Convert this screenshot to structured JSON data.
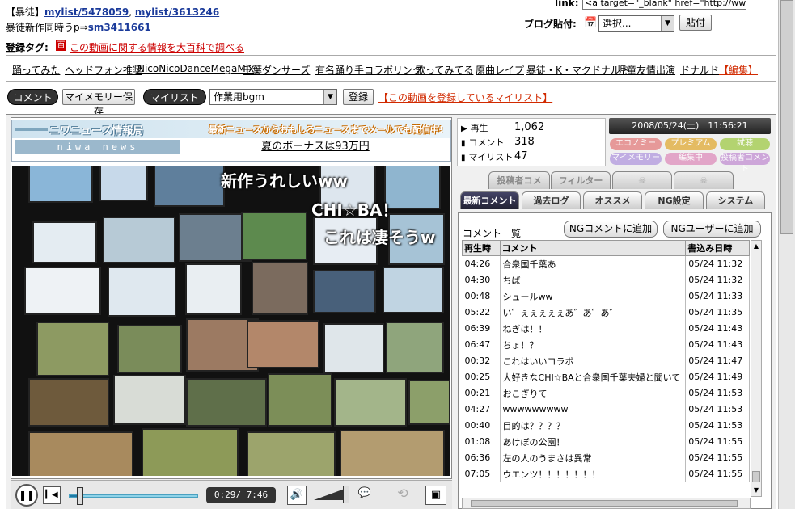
{
  "header": {
    "fav_prefix": "【暴徒】",
    "mylist1": "mylist/5478059",
    "sep": ", ",
    "mylist2": "mylist/3613246",
    "latest_prefix": "暴徒新作同時うp⇒",
    "latest_link": "sm3411661",
    "link_label": "link:",
    "link_value": "<a target=\"_blank\" href=\"http://www.ni",
    "blog_label": "ブログ貼付:",
    "blog_select": "選択...",
    "blog_button": "貼付"
  },
  "tags": {
    "label": "登録タグ:",
    "dict_badge": "百",
    "dict_link": "この動画に関する情報を大百科で調べる",
    "items": [
      "踊ってみた",
      "ヘッドフォン推奨",
      "NicoNicoDanceMegaMix",
      "千葉ダンサーズ",
      "有名踊り手コラボリンク",
      "歌ってみてる",
      "原曲レイプ",
      "暴徒・K・マクドナルド",
      "児童友情出演",
      "ドナルド"
    ],
    "edit": "【編集】"
  },
  "toolbar": {
    "comment_btn": "コメント",
    "memory_btn": "マイメモリー保存",
    "mylist_btn": "マイリスト",
    "mylist_select": "作業用bgm",
    "register_btn": "登録",
    "mylist_link": "【この動画を登録しているマイリスト】"
  },
  "news": {
    "title": "ニワニュース情報局",
    "tagline": "最新ニュースからおもしろニュースまでメールでも配信中!",
    "logo": "niwa news",
    "headline": "夏のボーナスは93万円"
  },
  "danmaku": [
    "新作うれしいww",
    "CHI☆BA！",
    "これは凄そうw"
  ],
  "controls": {
    "time": "0:29/ 7:46",
    "progress": 0.062
  },
  "stats": {
    "views_label": "再生",
    "views": "1,062",
    "comments_label": "コメント",
    "comments": "318",
    "mylist_label": "マイリスト",
    "mylist": "47"
  },
  "datetime": "2008/05/24(土)　11:56:21",
  "chips": [
    "エコノミー",
    "プレミアム",
    "試聴",
    "マイメモリー",
    "編集中",
    "投稿者コメント"
  ],
  "upper_tabs": [
    "投稿者コメ",
    "フィルター"
  ],
  "tabs": [
    "最新コメント",
    "過去ログ",
    "オススメ",
    "NG設定",
    "システム"
  ],
  "comment_panel": {
    "title": "コメント一覧",
    "ng_comment_btn": "NGコメントに追加",
    "ng_user_btn": "NGユーザーに追加",
    "headers": [
      "再生時",
      "コメント",
      "書込み日時"
    ],
    "rows": [
      [
        "04:26",
        "合衆国千葉あ",
        "05/24 11:32"
      ],
      [
        "04:30",
        "ちば",
        "05/24 11:32"
      ],
      [
        "00:48",
        "シュールww",
        "05/24 11:33"
      ],
      [
        "05:22",
        "い゛ぇぇぇぇぇあ゛あ゛あ゛",
        "05/24 11:35"
      ],
      [
        "06:39",
        "ねぎは！！",
        "05/24 11:43"
      ],
      [
        "06:47",
        "ちょ！？",
        "05/24 11:43"
      ],
      [
        "00:32",
        "これはいいコラボ",
        "05/24 11:47"
      ],
      [
        "00:25",
        "大好きなCHI☆BAと合衆国千葉夫婦と聞いて",
        "05/24 11:49"
      ],
      [
        "00:21",
        "おこぎりて",
        "05/24 11:53"
      ],
      [
        "04:27",
        "wwwwwwwww",
        "05/24 11:53"
      ],
      [
        "00:40",
        "目的は？？？？",
        "05/24 11:53"
      ],
      [
        "01:08",
        "あけぼの公園！",
        "05/24 11:55"
      ],
      [
        "06:36",
        "左の人のうまさは異常",
        "05/24 11:55"
      ],
      [
        "07:05",
        "ウエンツ！！！！！！！",
        "05/24 11:55"
      ]
    ]
  }
}
